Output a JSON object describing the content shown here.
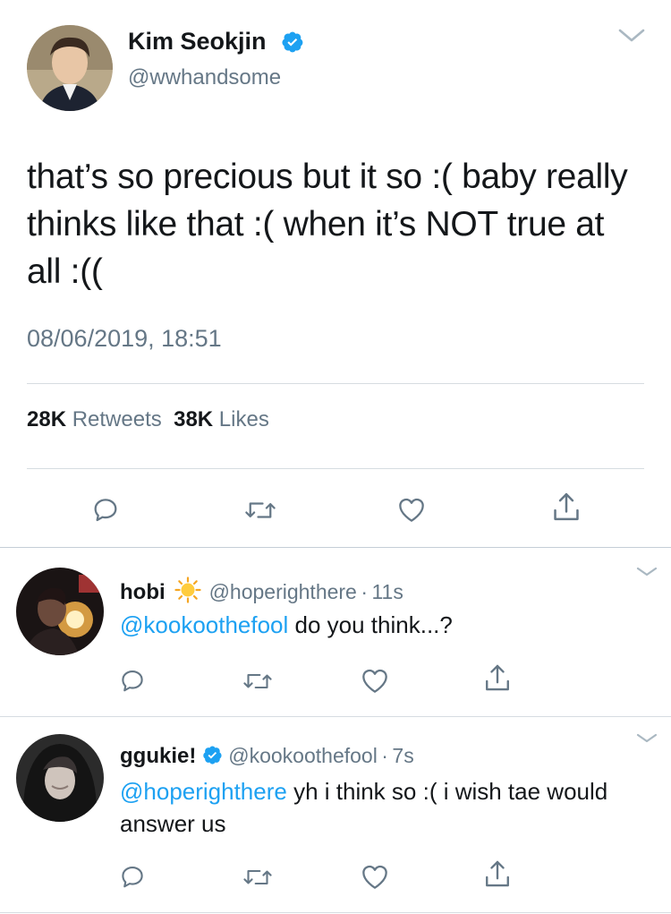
{
  "main_tweet": {
    "author": {
      "name": "Kim Seokjin",
      "handle": "@wwhandsome",
      "verified": true
    },
    "text": "that’s so precious but it so :( baby really thinks like that :( when it’s NOT true at all :((",
    "timestamp": "08/06/2019, 18:51",
    "retweets": {
      "count": "28K",
      "label": "Retweets"
    },
    "likes": {
      "count": "38K",
      "label": "Likes"
    },
    "icons": [
      "chevron-down-icon",
      "verified-badge-icon",
      "reply-icon",
      "retweet-icon",
      "like-icon",
      "share-icon"
    ]
  },
  "replies": [
    {
      "name": "hobi",
      "emoji": "sun-emoji",
      "handle": "@hoperighthere",
      "separator": "·",
      "time": "11s",
      "mention": "@kookoothefool",
      "text": " do you think...?"
    },
    {
      "name": "ggukie!",
      "verified": true,
      "handle": "@kookoothefool",
      "separator": "·",
      "time": "7s",
      "mention": "@hoperighthere",
      "text": " yh i think so :( i wish tae would answer us"
    }
  ],
  "colors": {
    "text": "#14171a",
    "secondary": "#657786",
    "link": "#1da1f2",
    "divider": "#d6dce1",
    "icon": "#657786"
  }
}
